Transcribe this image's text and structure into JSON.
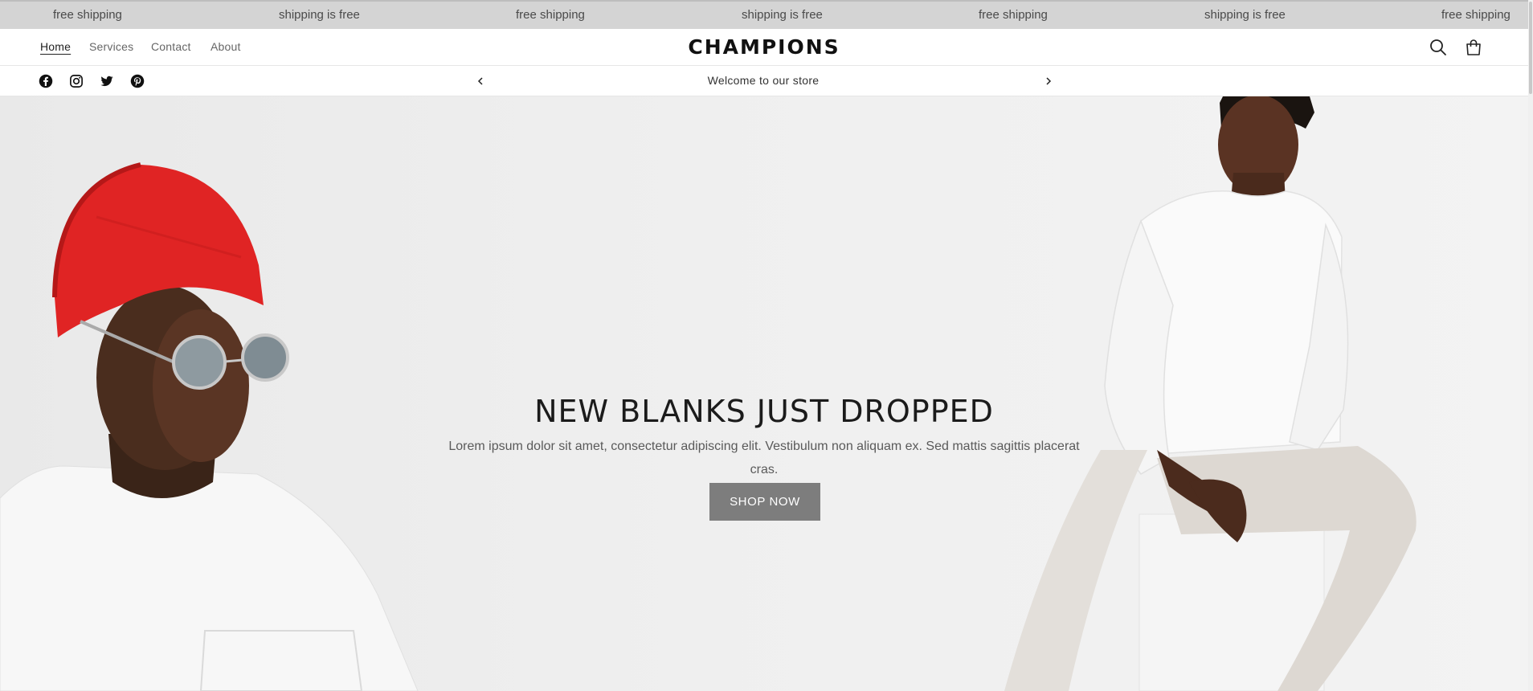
{
  "marquee": {
    "items": [
      "free shipping",
      "shipping is free",
      "free shipping",
      "shipping is free",
      "free shipping",
      "shipping is free",
      "free shipping"
    ]
  },
  "header": {
    "nav": [
      "Home",
      "Services",
      "Contact",
      "About"
    ],
    "active_nav": "Home",
    "logo": "CHAMPIONS",
    "icons": [
      "search-icon",
      "cart-icon"
    ]
  },
  "subbar": {
    "social_icons": [
      "facebook-icon",
      "instagram-icon",
      "twitter-icon",
      "pinterest-icon"
    ],
    "announcement": "Welcome to our store"
  },
  "hero": {
    "title": "NEW BLANKS JUST DROPPED",
    "text": "Lorem ipsum dolor sit amet, consectetur adipiscing elit. Vestibulum non aliquam ex. Sed mattis sagittis placerat cras.",
    "button": "SHOP NOW"
  },
  "colors": {
    "marquee_bg": "#d4d4d4",
    "button_bg": "#7d7d7d",
    "hero_bg": "#efefef",
    "beanie": "#e02424"
  }
}
